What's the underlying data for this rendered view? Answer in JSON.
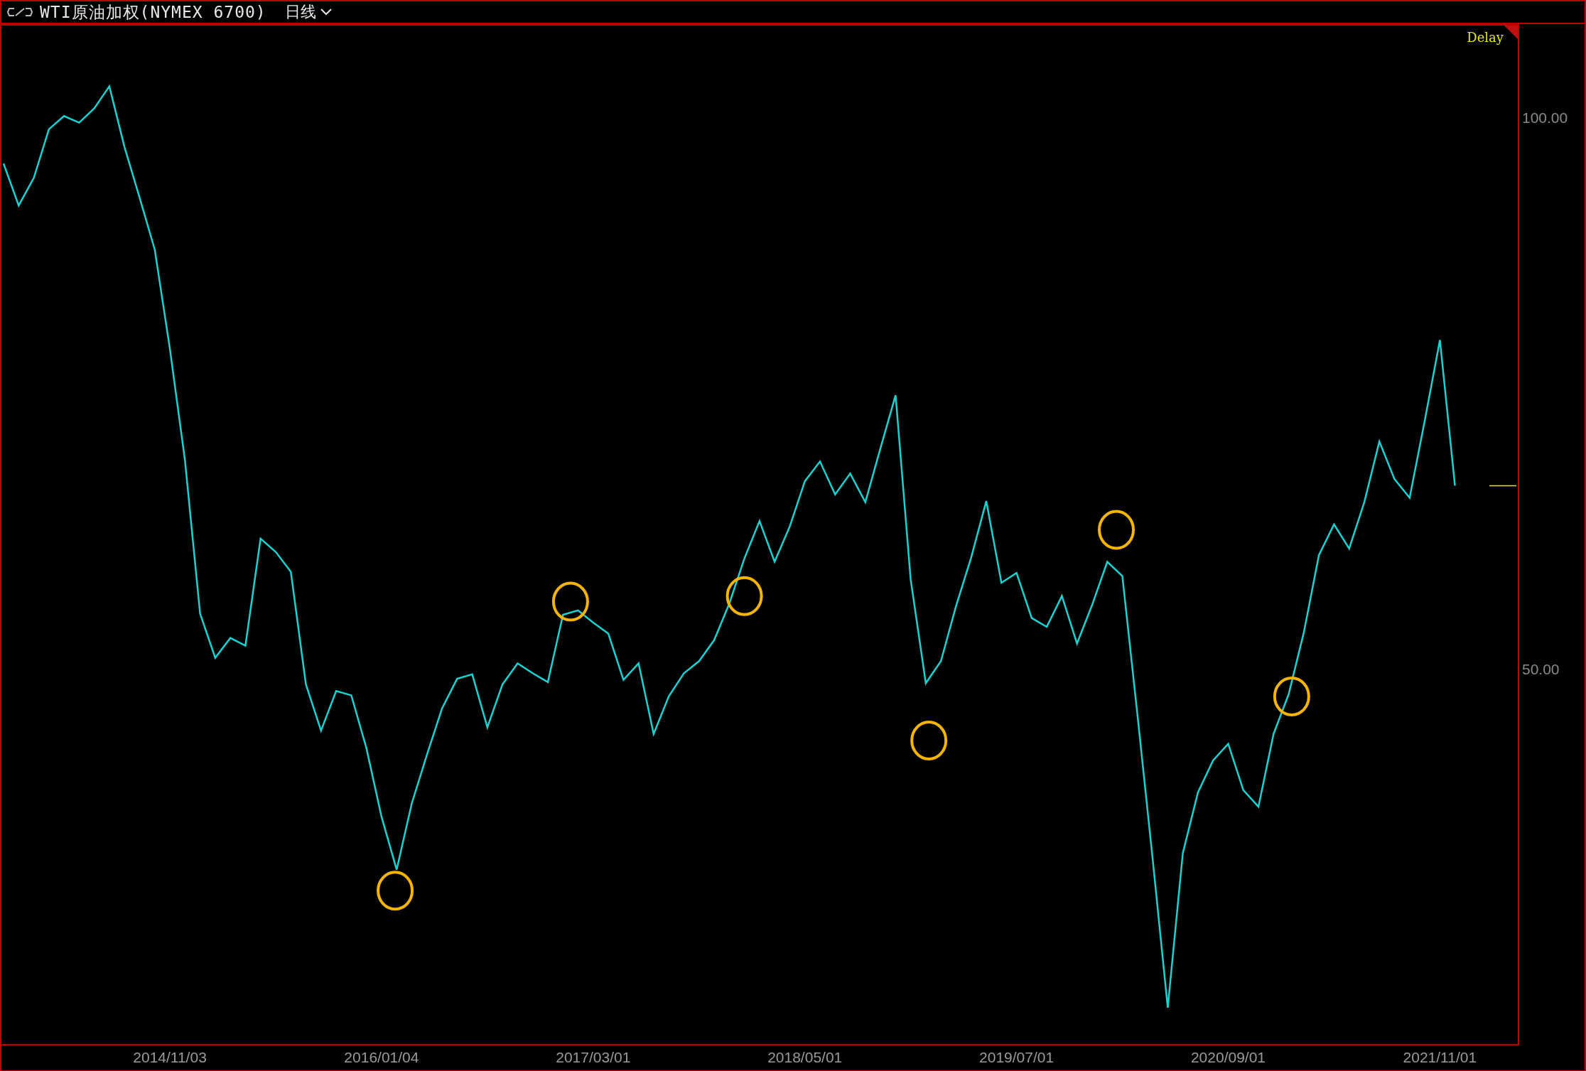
{
  "title_bar": {
    "title": "WTI原油加权(NYMEX 6700)",
    "period": "日线"
  },
  "chart": {
    "status": "Delay",
    "chart_data": {
      "type": "line",
      "ylim": [
        16.2,
        108.5
      ],
      "yticks": [
        {
          "value": 100,
          "label": "100.00"
        },
        {
          "value": 50,
          "label": "50.00"
        }
      ],
      "categories": [
        null,
        null,
        null,
        null,
        null,
        null,
        null,
        null,
        null,
        null,
        null,
        "2014/11/03",
        null,
        null,
        null,
        null,
        null,
        null,
        null,
        null,
        null,
        null,
        null,
        null,
        null,
        "2016/01/04",
        null,
        null,
        null,
        null,
        null,
        null,
        null,
        null,
        null,
        null,
        null,
        null,
        null,
        "2017/03/01",
        null,
        null,
        null,
        null,
        null,
        null,
        null,
        null,
        null,
        null,
        null,
        null,
        null,
        "2018/05/01",
        null,
        null,
        null,
        null,
        null,
        null,
        null,
        null,
        null,
        null,
        null,
        null,
        null,
        "2019/07/01",
        null,
        null,
        null,
        null,
        null,
        null,
        null,
        null,
        null,
        null,
        null,
        null,
        null,
        "2020/09/01",
        null,
        null,
        null,
        null,
        null,
        null,
        null,
        null,
        null,
        null,
        null,
        null,
        null,
        "2021/11/01",
        null
      ],
      "series": [
        {
          "color": "#19d3d3",
          "values": [
            96,
            92.2,
            94.7,
            99.1,
            100.3,
            99.7,
            101,
            103,
            97.5,
            92.9,
            88.2,
            79.2,
            69.1,
            55.2,
            51.2,
            53,
            52.3,
            62,
            60.8,
            59,
            48.8,
            44.6,
            48.2,
            47.8,
            43,
            36.8,
            32,
            38,
            42.4,
            46.6,
            49.3,
            49.7,
            44.9,
            48.8,
            50.7,
            49.8,
            49,
            55.1,
            55.5,
            54.4,
            53.4,
            49.2,
            50.7,
            44.3,
            47.7,
            49.8,
            50.9,
            52.8,
            56.1,
            60.2,
            63.6,
            59.9,
            63.1,
            67.2,
            69,
            66,
            67.9,
            65.3,
            70.2,
            75,
            58.3,
            48.9,
            50.9,
            55.9,
            60.3,
            65.4,
            58,
            58.9,
            54.8,
            54,
            56.8,
            52.5,
            56,
            59.9,
            58.6,
            46,
            33,
            19.5,
            33.5,
            39,
            41.9,
            43.4,
            39.2,
            37.7,
            44.3,
            47.9,
            53.5,
            60.5,
            63.3,
            61.1,
            65.3,
            70.8,
            67.4,
            65.7,
            72.7,
            80,
            66.8
          ]
        }
      ]
    }
  }
}
